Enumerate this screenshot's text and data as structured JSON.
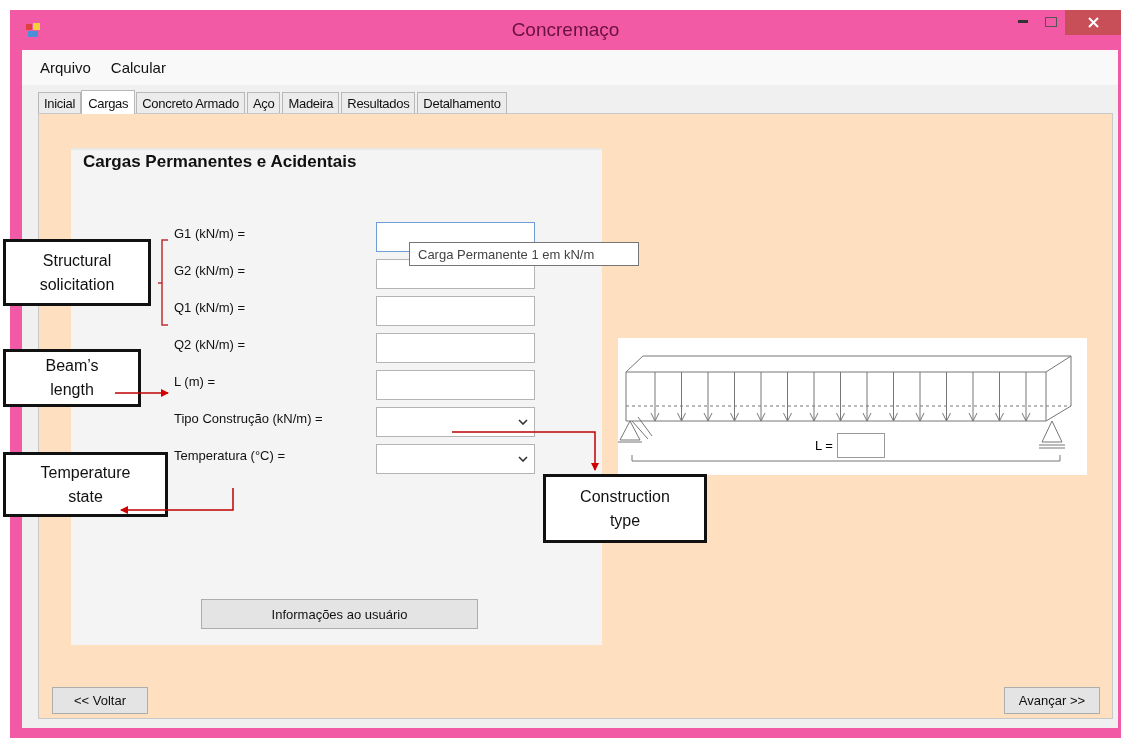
{
  "window": {
    "title": "Concremaço"
  },
  "menu": [
    {
      "label": "Arquivo"
    },
    {
      "label": "Calcular"
    }
  ],
  "tabs": [
    {
      "label": "Inicial",
      "selected": false
    },
    {
      "label": "Cargas",
      "selected": true
    },
    {
      "label": "Concreto Armado",
      "selected": false
    },
    {
      "label": "Aço",
      "selected": false
    },
    {
      "label": "Madeira",
      "selected": false
    },
    {
      "label": "Resultados",
      "selected": false
    },
    {
      "label": "Detalhamento",
      "selected": false
    }
  ],
  "group": {
    "title": "Cargas Permanentes e Acidentais",
    "fields": [
      {
        "label": "G1 (kN/m) =",
        "kind": "text",
        "focused": true
      },
      {
        "label": "G2 (kN/m) =",
        "kind": "text",
        "focused": false
      },
      {
        "label": "Q1 (kN/m) =",
        "kind": "text",
        "focused": false
      },
      {
        "label": "Q2 (kN/m) =",
        "kind": "text",
        "focused": false
      },
      {
        "label": "L (m) =",
        "kind": "text",
        "focused": false
      },
      {
        "label": "Tipo Construção (kN/m) =",
        "kind": "select",
        "focused": false
      },
      {
        "label": "Temperatura (°C) =",
        "kind": "select",
        "focused": false
      }
    ],
    "button": "Informações ao usuário"
  },
  "tooltip": "Carga Permanente 1 em kN/m",
  "beam_figure": {
    "label": "L ="
  },
  "footer": {
    "back": "<< Voltar",
    "next": "Avançar >>"
  },
  "callouts": [
    {
      "text": "Structural solicitation"
    },
    {
      "text": "Beam’s length"
    },
    {
      "text": "Temperature state"
    },
    {
      "text": "Construction type"
    }
  ]
}
